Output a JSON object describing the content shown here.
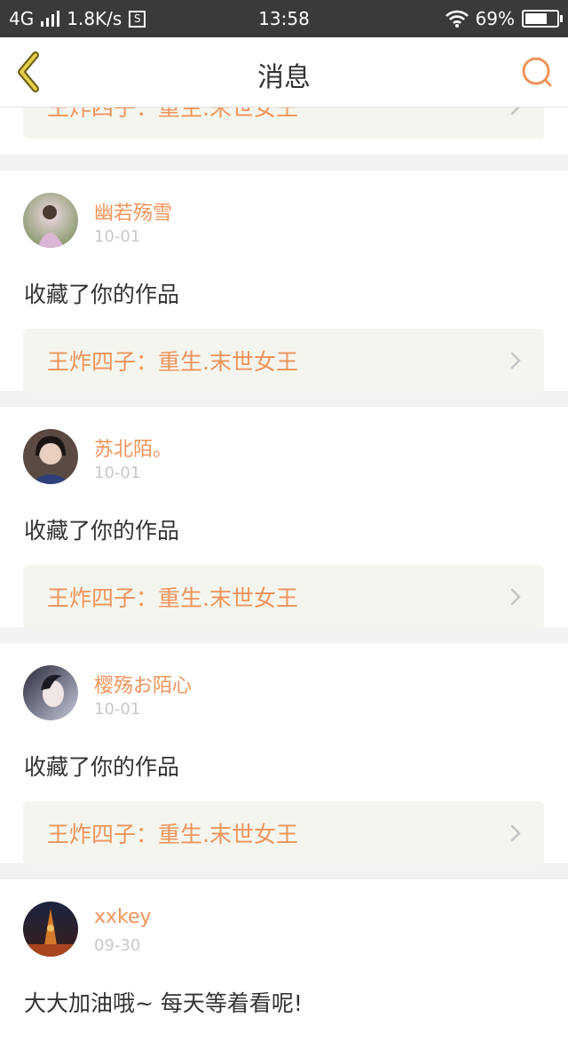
{
  "status_bar": {
    "network": "4G",
    "speed": "1.8K/s",
    "s_icon": "S",
    "time": "13:58",
    "battery": "69%"
  },
  "nav": {
    "title": "消息",
    "back_icon": "chevron-left-icon",
    "search_icon": "search-icon"
  },
  "colors": {
    "accent": "#f0945a",
    "back_icon": "#c9b23a",
    "work_bg": "#f5f5ef"
  },
  "top_partial": {
    "work_title": "王炸四子：重生.末世女王"
  },
  "messages": [
    {
      "username": "幽若殇雪",
      "date": "10-01",
      "action": "收藏了你的作品",
      "work_title": "王炸四子：重生.末世女王"
    },
    {
      "username": "苏北陌。",
      "date": "10-01",
      "action": "收藏了你的作品",
      "work_title": "王炸四子：重生.末世女王"
    },
    {
      "username": "樱殇お陌心",
      "date": "10-01",
      "action": "收藏了你的作品",
      "work_title": "王炸四子：重生.末世女王"
    },
    {
      "username": "xxkey",
      "date": "09-30",
      "action": "大大加油哦~ 每天等着看呢!"
    }
  ]
}
